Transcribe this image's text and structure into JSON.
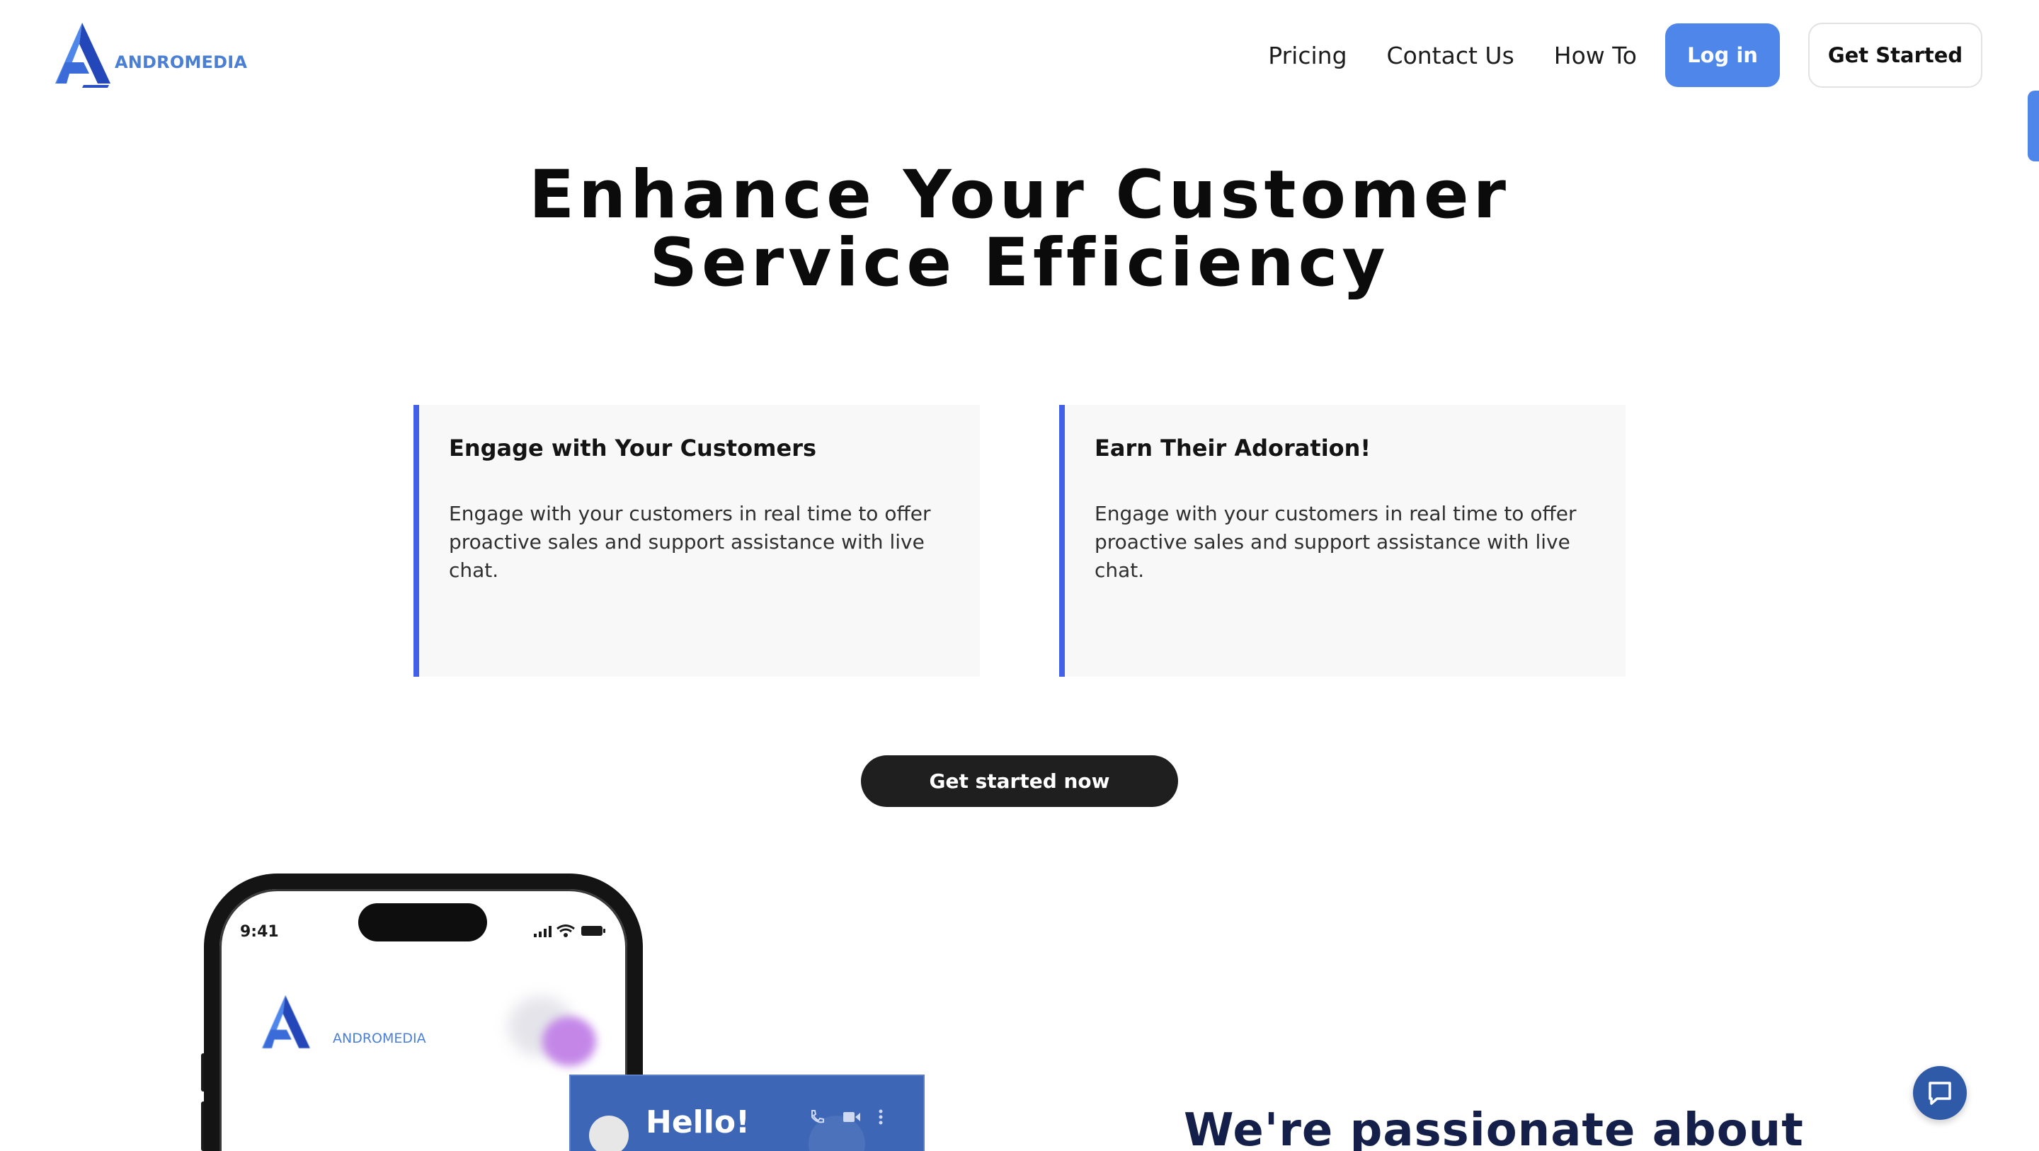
{
  "brand": {
    "name": "ANDROMEDIA",
    "color": "#4a7fd4"
  },
  "nav": {
    "links": [
      "Pricing",
      "Contact Us",
      "How To"
    ],
    "login_label": "Log in",
    "get_started_label": "Get Started"
  },
  "hero": {
    "title_line1": "Enhance Your Customer",
    "title_line2": "Service Efficiency"
  },
  "features": [
    {
      "title": "Engage with Your Customers",
      "body": "Engage with your customers in real time to offer proactive sales and support assistance with live chat."
    },
    {
      "title": "Earn Their Adoration!",
      "body": "Engage with your customers in real time to offer proactive sales and support assistance with live chat."
    }
  ],
  "cta_label": "Get started now",
  "phone": {
    "time": "9:41",
    "app_name": "ANDROMEDIA",
    "chat_greeting": "Hello!"
  },
  "section2": {
    "heading": "We're passionate about"
  },
  "colors": {
    "accent": "#4f86ea",
    "card_border": "#4161e6",
    "cta_bg": "#1f1f1f",
    "chat_card": "#3d66b6",
    "heading_dark": "#15204a"
  },
  "icons": [
    "andromedia-logo-icon",
    "signal-icon",
    "wifi-icon",
    "battery-icon",
    "phone-call-icon",
    "video-call-icon",
    "more-vertical-icon",
    "chat-bubble-icon"
  ]
}
